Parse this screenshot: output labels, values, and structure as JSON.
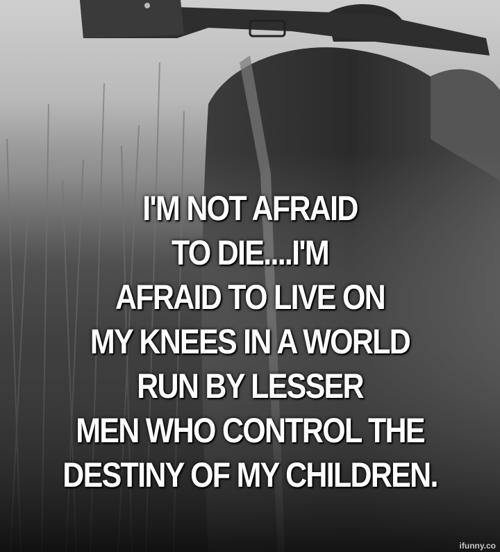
{
  "caption": {
    "lines": [
      "I'M NOT AFRAID",
      "TO DIE....I'M",
      "AFRAID TO LIVE ON",
      "MY KNEES IN A WORLD",
      "RUN BY LESSER",
      "MEN WHO CONTROL THE",
      "DESTINY OF MY CHILDREN."
    ]
  },
  "watermark": "ifunny.co",
  "colors": {
    "text": "#ffffff",
    "sky": "#c8c8c8",
    "ground": "#161616"
  }
}
